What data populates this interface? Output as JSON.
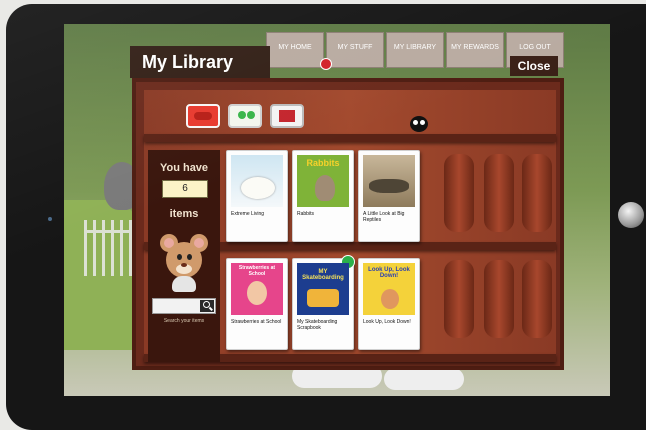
{
  "library": {
    "title": "My Library",
    "close_label": "Close"
  },
  "nav": {
    "tabs": [
      {
        "label": "MY HOME"
      },
      {
        "label": "MY STUFF"
      },
      {
        "label": "MY LIBRARY"
      },
      {
        "label": "MY REWARDS"
      },
      {
        "label": "LOG OUT"
      }
    ]
  },
  "side": {
    "you_have": "You have",
    "count": "6",
    "items": "items",
    "search_placeholder": "",
    "search_hint": "Search your items"
  },
  "filters": [
    {
      "icon": "red-brand-icon"
    },
    {
      "icon": "green-frog-icon"
    },
    {
      "icon": "red-book-icon"
    }
  ],
  "books": [
    {
      "title": "Extreme Living"
    },
    {
      "title": "Rabbits",
      "cover_text": "Rabbits"
    },
    {
      "title": "A Little Look at Big Reptiles"
    },
    {
      "title": "Strawberries at School",
      "cover_text": "Strawberries at School"
    },
    {
      "title": "My Skateboarding Scrapbook",
      "cover_text": "MY Skateboarding"
    },
    {
      "title": "Look Up, Look Down!",
      "cover_text": "Look Up, Look Down!"
    }
  ],
  "colors": {
    "frame": "#161616",
    "bookcase": "#6b2a1c",
    "title_bar": "#332017",
    "tab": "#b9aba1"
  }
}
